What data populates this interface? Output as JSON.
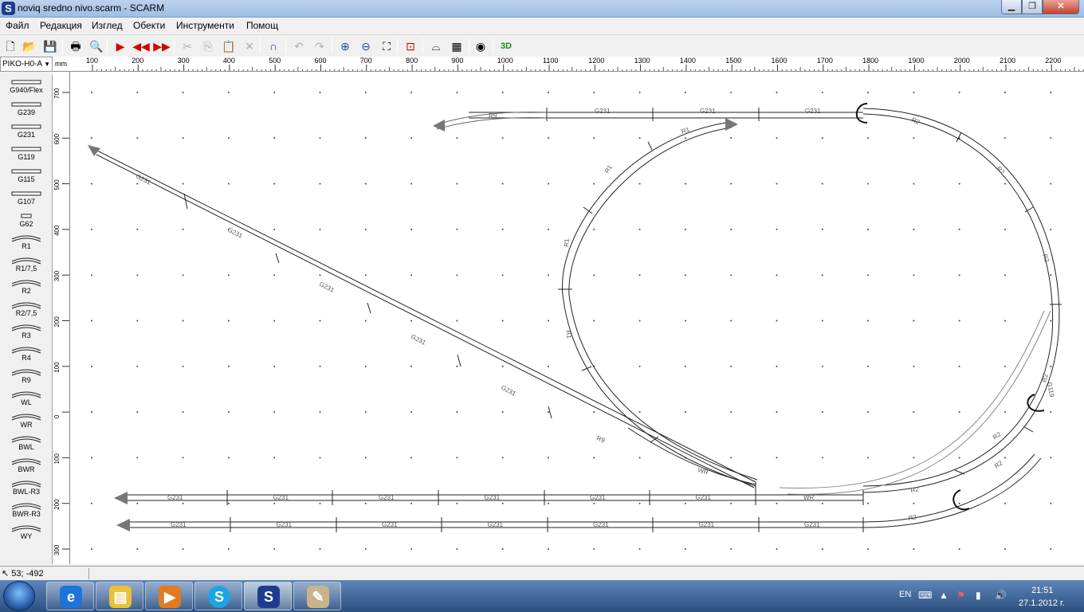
{
  "window": {
    "title": "noviq sredno nivo.scarm - SCARM",
    "app_icon": "S"
  },
  "menu": [
    "Файл",
    "Редакция",
    "Изглед",
    "Обекти",
    "Инструменти",
    "Помощ"
  ],
  "toolbar": {
    "zoom3d_label": "3D"
  },
  "library": {
    "selected": "PIKO-H0-A"
  },
  "palette": [
    "G940/Flex",
    "G239",
    "G231",
    "G119",
    "G115",
    "G107",
    "G62",
    "R1",
    "R1/7,5",
    "R2",
    "R2/7,5",
    "R3",
    "R4",
    "R9",
    "WL",
    "WR",
    "BWL",
    "BWR",
    "BWL-R3",
    "BWR-R3",
    "WY"
  ],
  "ruler": {
    "units": "mm",
    "h_ticks": [
      "100",
      "200",
      "300",
      "400",
      "500",
      "600",
      "700",
      "800",
      "900",
      "1000",
      "1100",
      "1200",
      "1300",
      "1400",
      "1500",
      "1600",
      "1700",
      "1800",
      "1900",
      "2000",
      "2100",
      "2200"
    ],
    "v_ticks": [
      "700",
      "600",
      "500",
      "400",
      "300",
      "200",
      "100",
      "0",
      "100",
      "200",
      "300"
    ]
  },
  "tracks": {
    "labels": [
      {
        "t": "R9"
      },
      {
        "t": "G231"
      },
      {
        "t": "G231"
      },
      {
        "t": "G231"
      },
      {
        "t": "R2"
      },
      {
        "t": "R1"
      },
      {
        "t": "R1"
      },
      {
        "t": "R1"
      },
      {
        "t": "R1"
      },
      {
        "t": "R2"
      },
      {
        "t": "R2"
      },
      {
        "t": "G231"
      },
      {
        "t": "G231"
      },
      {
        "t": "G231"
      },
      {
        "t": "G231"
      },
      {
        "t": "G231"
      },
      {
        "t": "R9"
      },
      {
        "t": "WR"
      },
      {
        "t": "R2"
      },
      {
        "t": "R2"
      },
      {
        "t": "R2"
      },
      {
        "t": "G119"
      },
      {
        "t": "WR"
      },
      {
        "t": "R2"
      },
      {
        "t": "R2"
      }
    ],
    "bottom1": [
      "G231",
      "G231",
      "G231",
      "G231",
      "G231",
      "G231"
    ],
    "bottom2": [
      "G231",
      "G231",
      "G231",
      "G231",
      "G231",
      "G231",
      "G231"
    ]
  },
  "status": {
    "coords": "53; -492"
  },
  "taskbar": {
    "lang": "EN",
    "time": "21:51",
    "date": "27.1.2012 г."
  }
}
